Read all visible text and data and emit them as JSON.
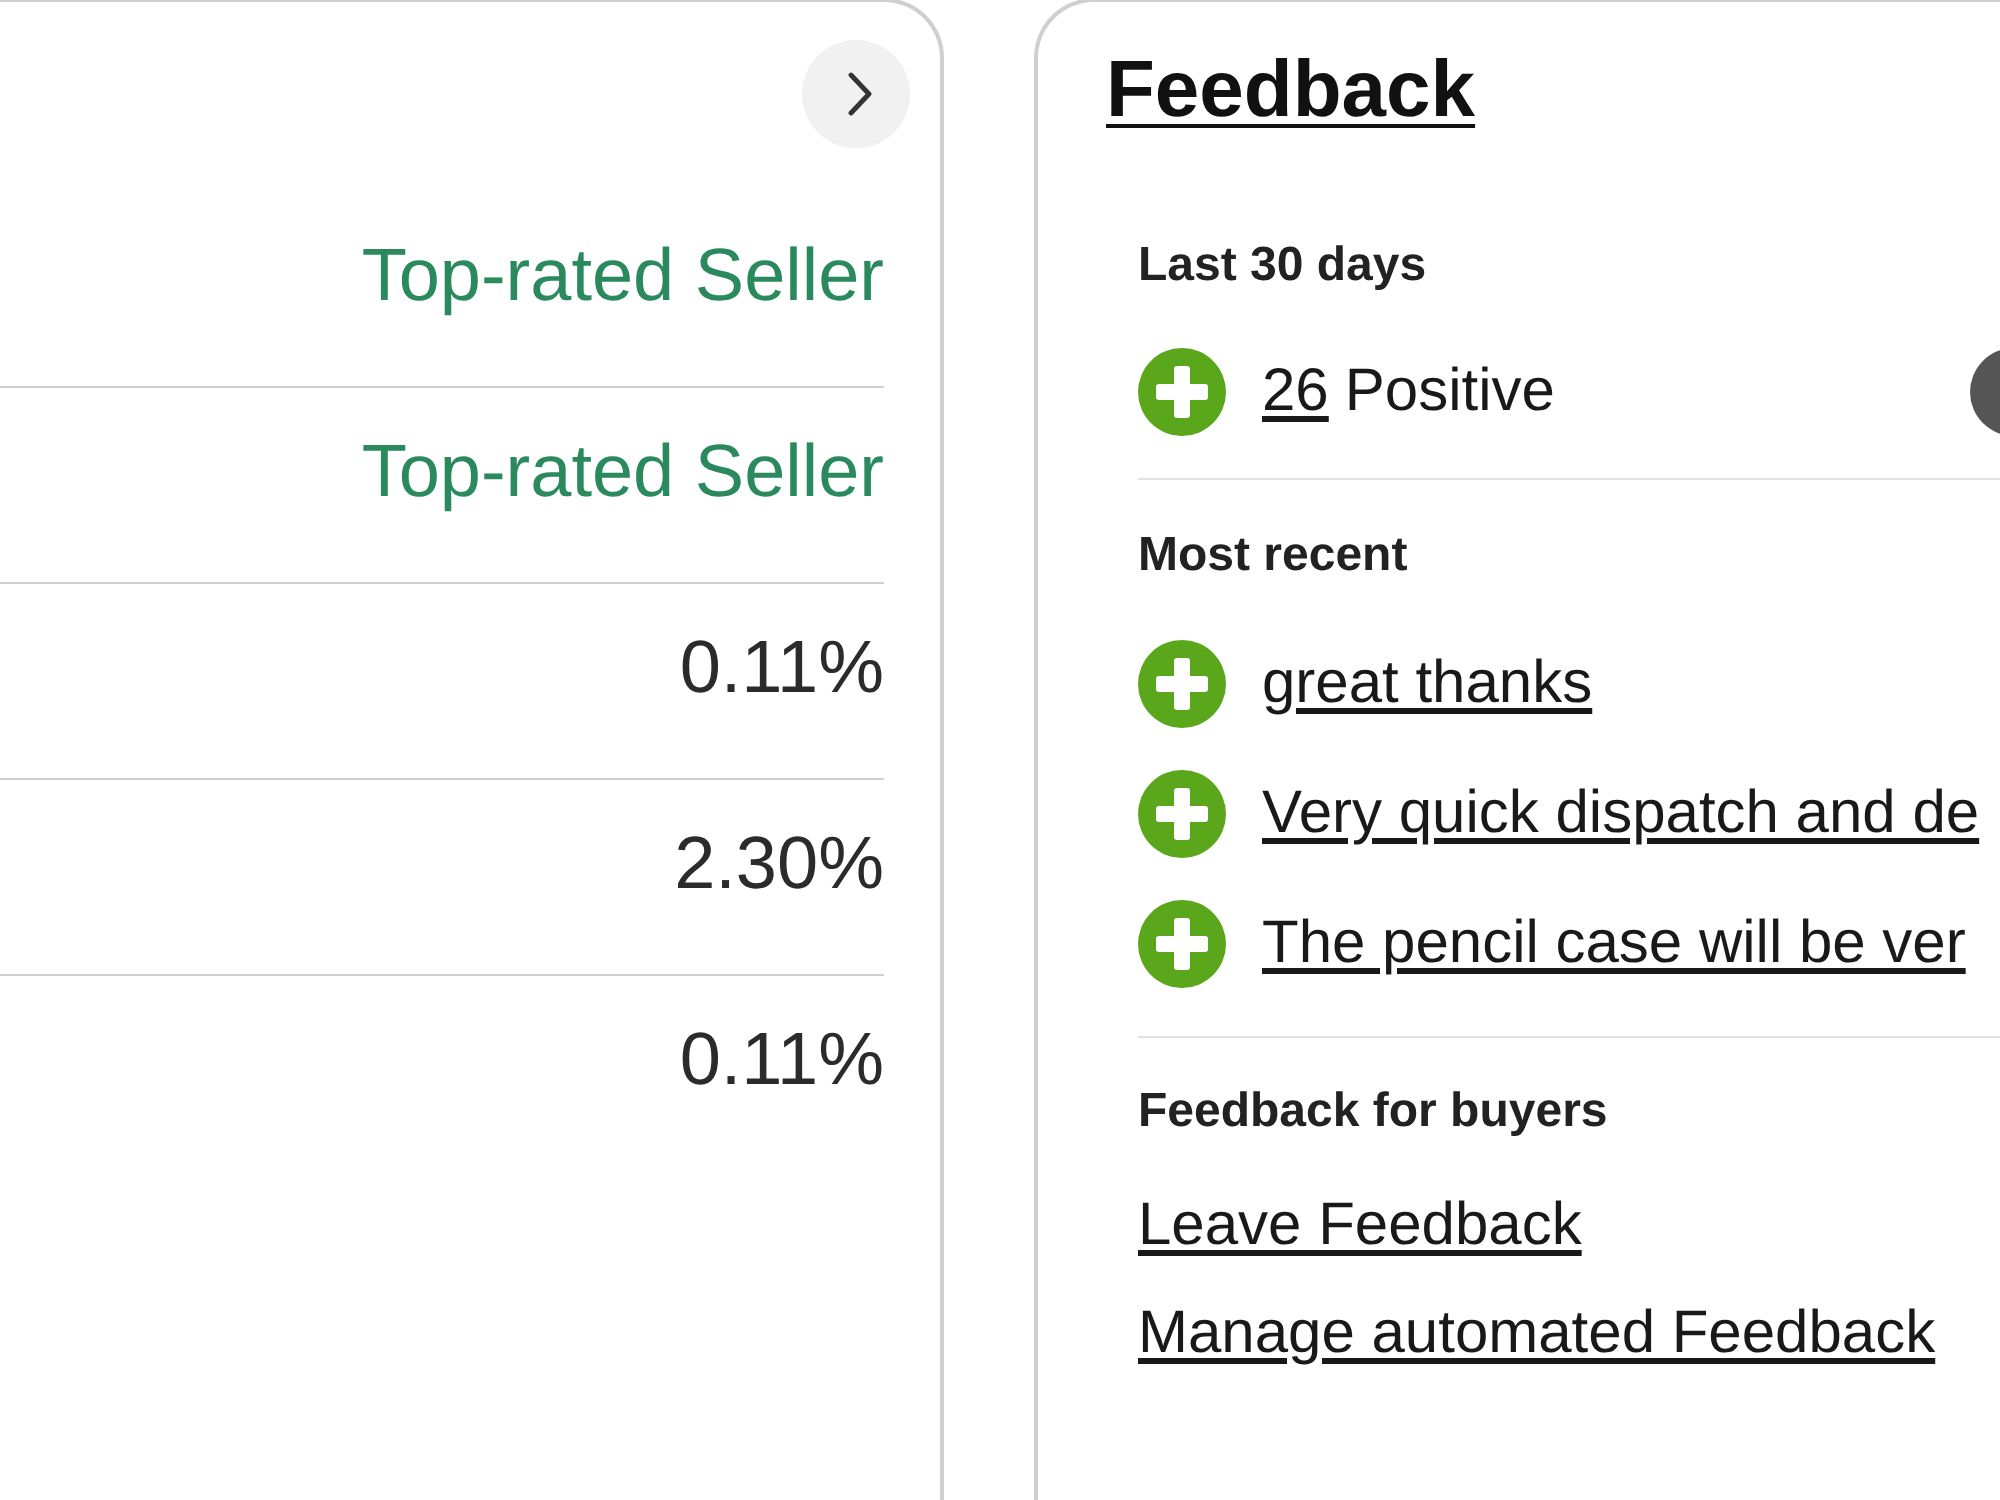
{
  "seller_panel": {
    "rows": [
      {
        "kind": "status",
        "value": "Top-rated Seller"
      },
      {
        "kind": "status",
        "value": "Top-rated Seller"
      },
      {
        "kind": "percent",
        "value": "0.11%"
      },
      {
        "kind": "percent",
        "value": "2.30%"
      },
      {
        "kind": "percent",
        "value": "0.11%"
      }
    ]
  },
  "feedback_panel": {
    "title": "Feedback",
    "last_30_days": {
      "label": "Last 30 days",
      "ratings": [
        {
          "kind": "positive",
          "count": "26",
          "label": "Positive"
        },
        {
          "kind": "neutral"
        }
      ]
    },
    "most_recent": {
      "label": "Most recent",
      "items": [
        {
          "kind": "positive",
          "text": "great thanks"
        },
        {
          "kind": "positive",
          "text": "Very quick dispatch and de"
        },
        {
          "kind": "positive",
          "text": "The pencil case will be ver"
        }
      ]
    },
    "for_buyers": {
      "label": "Feedback for buyers",
      "links": [
        "Leave Feedback",
        "Manage automated Feedback"
      ]
    }
  }
}
